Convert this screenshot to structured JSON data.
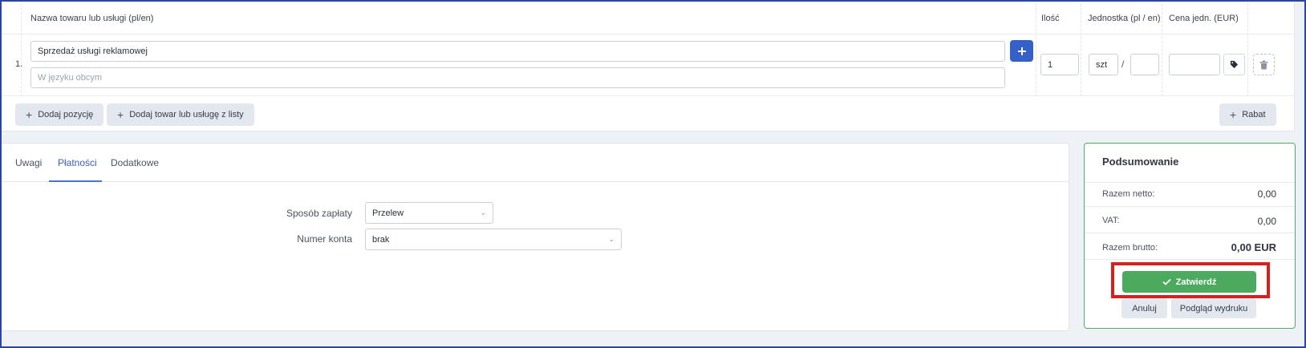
{
  "items_table": {
    "headers": {
      "name": "Nazwa towaru lub usługi (pl/en)",
      "qty": "Ilość",
      "unit": "Jednostka (pl / en)",
      "price": "Cena jedn. (EUR)"
    },
    "row": {
      "number": "1.",
      "name_value": "Sprzedaż usługi reklamowej",
      "foreign_placeholder": "W języku obcym",
      "qty_value": "1",
      "unit_pl": "szt",
      "unit_en": "",
      "unit_separator": "/",
      "price_value": ""
    },
    "buttons": {
      "add_row": "Dodaj pozycję",
      "add_from_list": "Dodaj towar lub usługę z listy",
      "discount": "Rabat"
    }
  },
  "tabs": [
    {
      "label": "Uwagi"
    },
    {
      "label": "Płatności"
    },
    {
      "label": "Dodatkowe"
    }
  ],
  "active_tab": "Płatności",
  "payment": {
    "method_label": "Sposób zapłaty",
    "method_value": "Przelew",
    "account_label": "Numer konta",
    "account_value": "brak"
  },
  "summary": {
    "title": "Podsumowanie",
    "net_label": "Razem netto:",
    "net_value": "0,00",
    "vat_label": "VAT:",
    "vat_value": "0,00",
    "gross_label": "Razem brutto:",
    "gross_value": "0,00 EUR",
    "confirm_label": "Zatwierdź",
    "cancel_label": "Anuluj",
    "preview_label": "Podgląd wydruku"
  },
  "colors": {
    "primary_blue": "#3560c8",
    "confirm_green": "#4caa5e",
    "summary_border": "#5aa865",
    "highlight_red": "#d5201f"
  }
}
